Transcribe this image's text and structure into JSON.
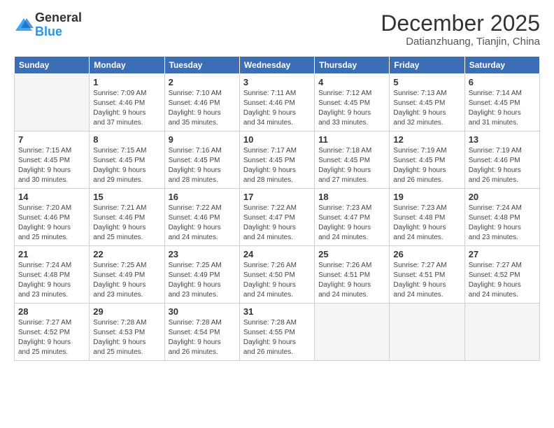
{
  "header": {
    "logo_general": "General",
    "logo_blue": "Blue",
    "month_title": "December 2025",
    "subtitle": "Datianzhuang, Tianjin, China"
  },
  "days_of_week": [
    "Sunday",
    "Monday",
    "Tuesday",
    "Wednesday",
    "Thursday",
    "Friday",
    "Saturday"
  ],
  "weeks": [
    [
      {
        "day": "",
        "empty": true
      },
      {
        "day": "1",
        "sunrise": "7:09 AM",
        "sunset": "4:46 PM",
        "daylight": "9 hours and 37 minutes."
      },
      {
        "day": "2",
        "sunrise": "7:10 AM",
        "sunset": "4:46 PM",
        "daylight": "9 hours and 35 minutes."
      },
      {
        "day": "3",
        "sunrise": "7:11 AM",
        "sunset": "4:46 PM",
        "daylight": "9 hours and 34 minutes."
      },
      {
        "day": "4",
        "sunrise": "7:12 AM",
        "sunset": "4:45 PM",
        "daylight": "9 hours and 33 minutes."
      },
      {
        "day": "5",
        "sunrise": "7:13 AM",
        "sunset": "4:45 PM",
        "daylight": "9 hours and 32 minutes."
      },
      {
        "day": "6",
        "sunrise": "7:14 AM",
        "sunset": "4:45 PM",
        "daylight": "9 hours and 31 minutes."
      }
    ],
    [
      {
        "day": "7",
        "sunrise": "7:15 AM",
        "sunset": "4:45 PM",
        "daylight": "9 hours and 30 minutes."
      },
      {
        "day": "8",
        "sunrise": "7:15 AM",
        "sunset": "4:45 PM",
        "daylight": "9 hours and 29 minutes."
      },
      {
        "day": "9",
        "sunrise": "7:16 AM",
        "sunset": "4:45 PM",
        "daylight": "9 hours and 28 minutes."
      },
      {
        "day": "10",
        "sunrise": "7:17 AM",
        "sunset": "4:45 PM",
        "daylight": "9 hours and 28 minutes."
      },
      {
        "day": "11",
        "sunrise": "7:18 AM",
        "sunset": "4:45 PM",
        "daylight": "9 hours and 27 minutes."
      },
      {
        "day": "12",
        "sunrise": "7:19 AM",
        "sunset": "4:45 PM",
        "daylight": "9 hours and 26 minutes."
      },
      {
        "day": "13",
        "sunrise": "7:19 AM",
        "sunset": "4:46 PM",
        "daylight": "9 hours and 26 minutes."
      }
    ],
    [
      {
        "day": "14",
        "sunrise": "7:20 AM",
        "sunset": "4:46 PM",
        "daylight": "9 hours and 25 minutes."
      },
      {
        "day": "15",
        "sunrise": "7:21 AM",
        "sunset": "4:46 PM",
        "daylight": "9 hours and 25 minutes."
      },
      {
        "day": "16",
        "sunrise": "7:22 AM",
        "sunset": "4:46 PM",
        "daylight": "9 hours and 24 minutes."
      },
      {
        "day": "17",
        "sunrise": "7:22 AM",
        "sunset": "4:47 PM",
        "daylight": "9 hours and 24 minutes."
      },
      {
        "day": "18",
        "sunrise": "7:23 AM",
        "sunset": "4:47 PM",
        "daylight": "9 hours and 24 minutes."
      },
      {
        "day": "19",
        "sunrise": "7:23 AM",
        "sunset": "4:48 PM",
        "daylight": "9 hours and 24 minutes."
      },
      {
        "day": "20",
        "sunrise": "7:24 AM",
        "sunset": "4:48 PM",
        "daylight": "9 hours and 23 minutes."
      }
    ],
    [
      {
        "day": "21",
        "sunrise": "7:24 AM",
        "sunset": "4:48 PM",
        "daylight": "9 hours and 23 minutes."
      },
      {
        "day": "22",
        "sunrise": "7:25 AM",
        "sunset": "4:49 PM",
        "daylight": "9 hours and 23 minutes."
      },
      {
        "day": "23",
        "sunrise": "7:25 AM",
        "sunset": "4:49 PM",
        "daylight": "9 hours and 23 minutes."
      },
      {
        "day": "24",
        "sunrise": "7:26 AM",
        "sunset": "4:50 PM",
        "daylight": "9 hours and 24 minutes."
      },
      {
        "day": "25",
        "sunrise": "7:26 AM",
        "sunset": "4:51 PM",
        "daylight": "9 hours and 24 minutes."
      },
      {
        "day": "26",
        "sunrise": "7:27 AM",
        "sunset": "4:51 PM",
        "daylight": "9 hours and 24 minutes."
      },
      {
        "day": "27",
        "sunrise": "7:27 AM",
        "sunset": "4:52 PM",
        "daylight": "9 hours and 24 minutes."
      }
    ],
    [
      {
        "day": "28",
        "sunrise": "7:27 AM",
        "sunset": "4:52 PM",
        "daylight": "9 hours and 25 minutes."
      },
      {
        "day": "29",
        "sunrise": "7:28 AM",
        "sunset": "4:53 PM",
        "daylight": "9 hours and 25 minutes."
      },
      {
        "day": "30",
        "sunrise": "7:28 AM",
        "sunset": "4:54 PM",
        "daylight": "9 hours and 26 minutes."
      },
      {
        "day": "31",
        "sunrise": "7:28 AM",
        "sunset": "4:55 PM",
        "daylight": "9 hours and 26 minutes."
      },
      {
        "day": "",
        "empty": true
      },
      {
        "day": "",
        "empty": true
      },
      {
        "day": "",
        "empty": true
      }
    ]
  ],
  "labels": {
    "sunrise_prefix": "Sunrise: ",
    "sunset_prefix": "Sunset: ",
    "daylight_prefix": "Daylight: "
  }
}
